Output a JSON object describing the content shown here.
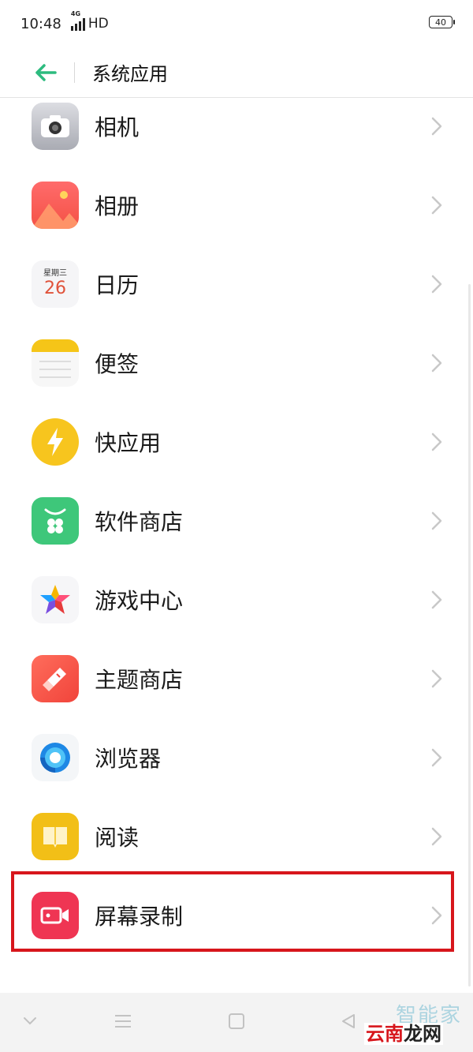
{
  "status_bar": {
    "time": "10:48",
    "network": "4G",
    "hd": "HD",
    "battery": "40"
  },
  "header": {
    "title": "系统应用"
  },
  "items": [
    {
      "label": "相机",
      "icon": "camera-icon"
    },
    {
      "label": "相册",
      "icon": "photos-icon"
    },
    {
      "label": "日历",
      "icon": "calendar-icon",
      "weekday": "星期三",
      "day": "26"
    },
    {
      "label": "便签",
      "icon": "notes-icon"
    },
    {
      "label": "快应用",
      "icon": "quick-app-icon"
    },
    {
      "label": "软件商店",
      "icon": "app-store-icon"
    },
    {
      "label": "游戏中心",
      "icon": "game-center-icon"
    },
    {
      "label": "主题商店",
      "icon": "theme-store-icon"
    },
    {
      "label": "浏览器",
      "icon": "browser-icon"
    },
    {
      "label": "阅读",
      "icon": "reading-icon"
    },
    {
      "label": "屏幕录制",
      "icon": "screen-recording-icon",
      "highlighted": true
    }
  ],
  "watermark": {
    "top": "智能家",
    "bottom_1": "云南",
    "bottom_2": "龙网"
  },
  "colors": {
    "accent": "#2dbb7f",
    "highlight": "#d7161c"
  }
}
